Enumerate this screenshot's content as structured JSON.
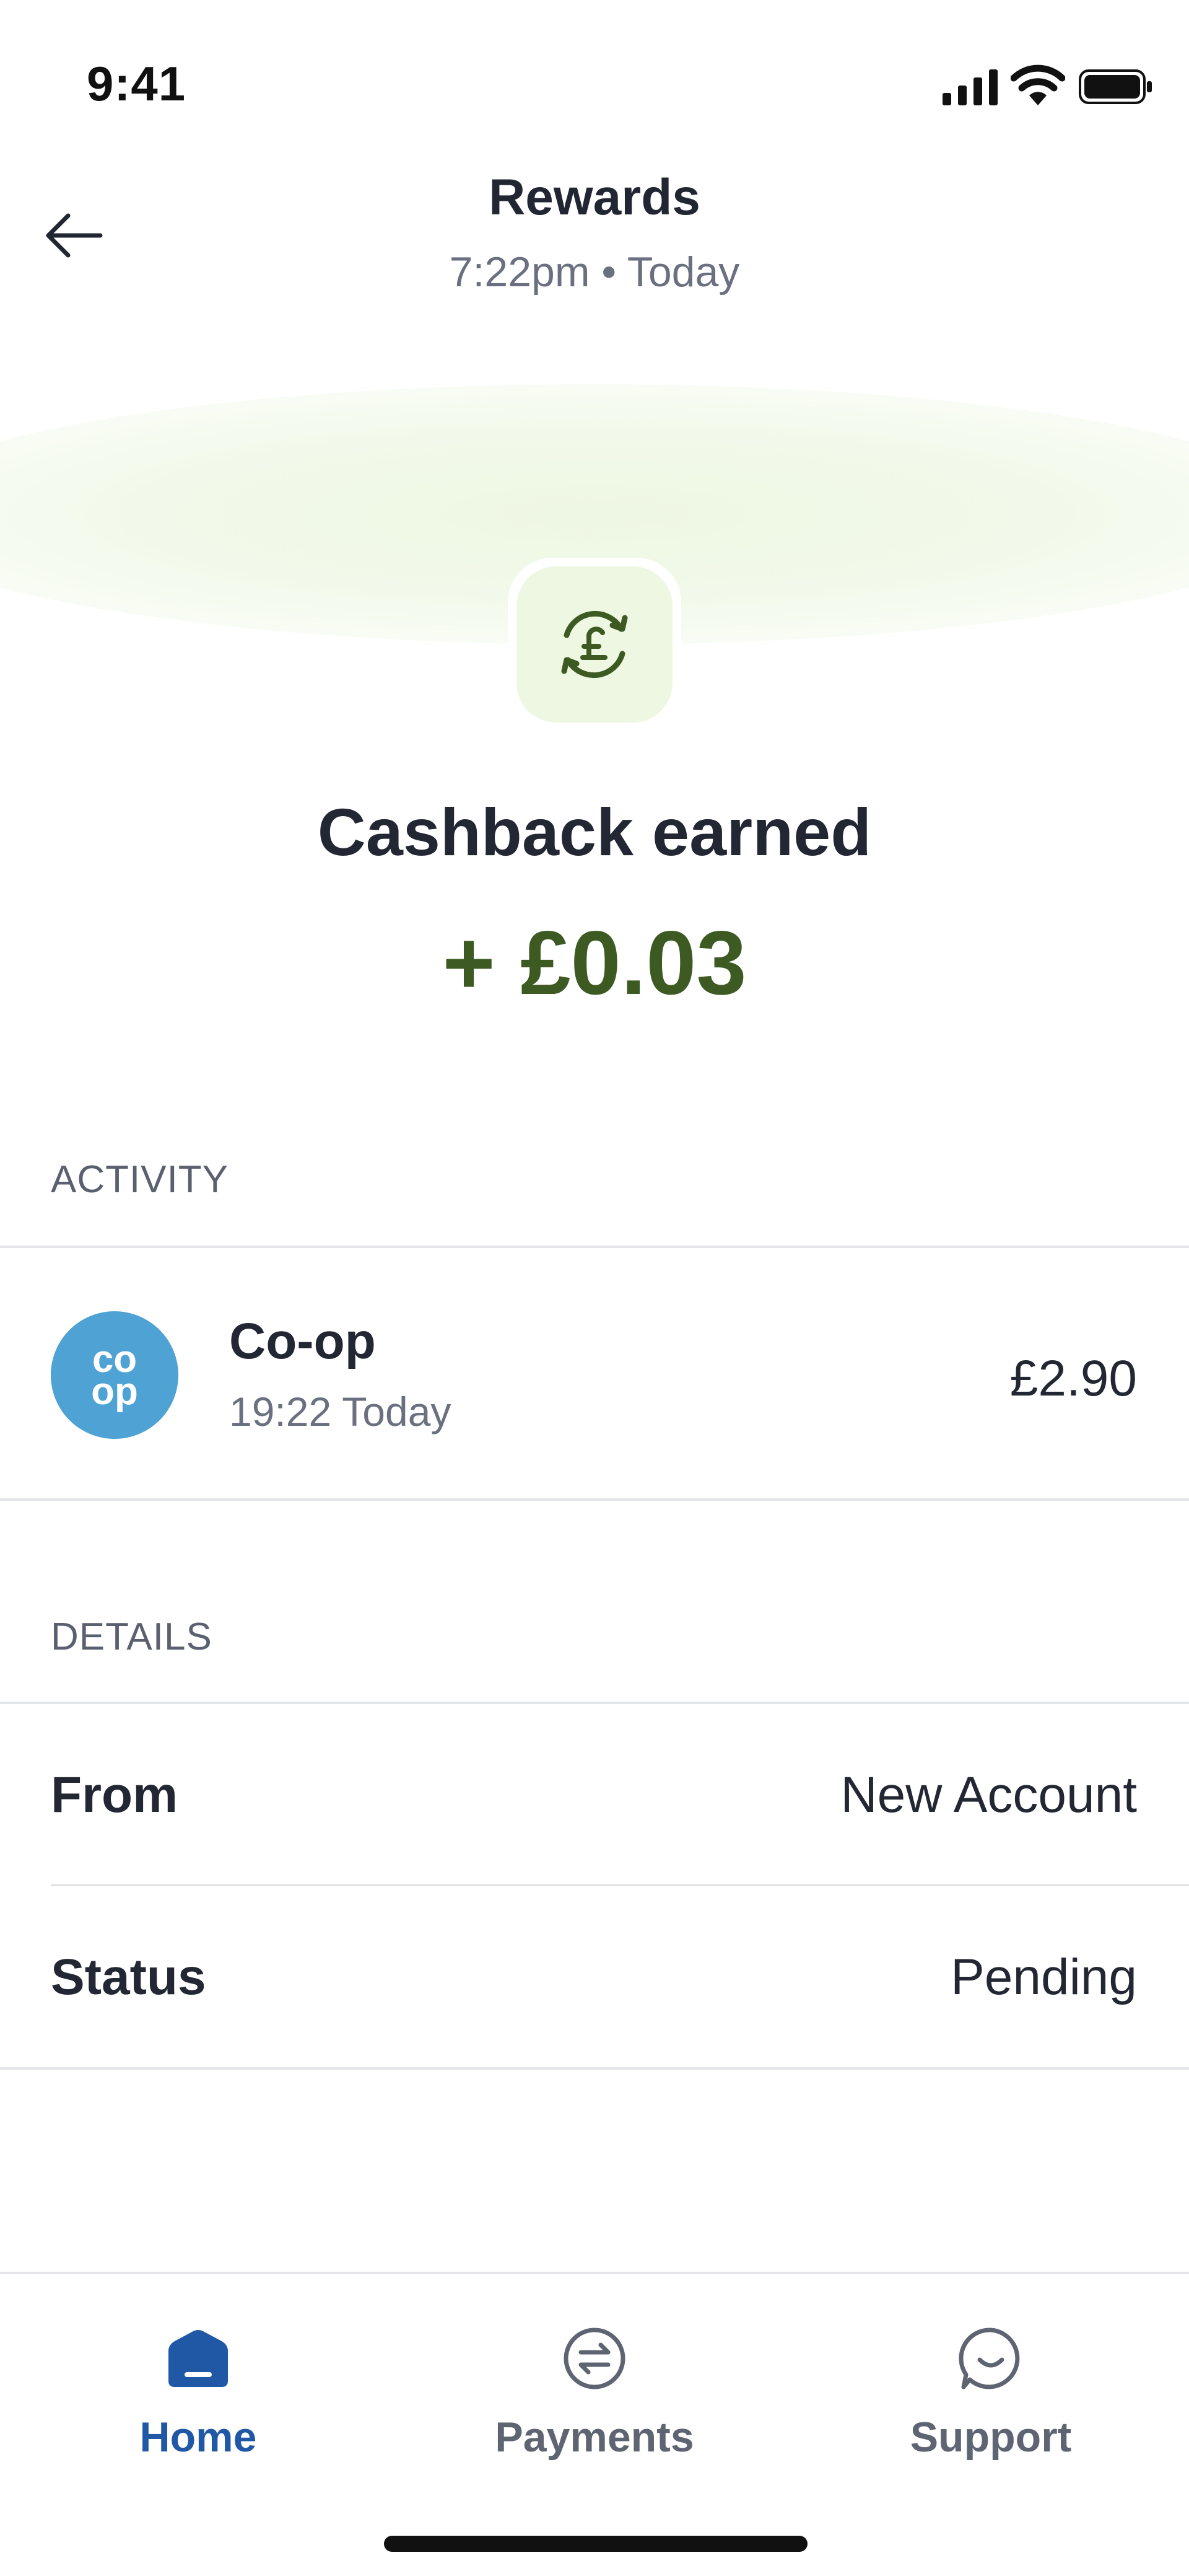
{
  "status_bar": {
    "time": "9:41",
    "icons": [
      "signal-icon",
      "wifi-icon",
      "battery-icon"
    ]
  },
  "header": {
    "title": "Rewards",
    "subtitle": "7:22pm • Today",
    "back_icon": "arrow-left-icon"
  },
  "hero": {
    "icon": "pound-refresh-icon",
    "title": "Cashback earned",
    "amount": "+ £0.03"
  },
  "activity": {
    "label": "ACTIVITY",
    "merchant": {
      "logo_text_top": "co",
      "logo_text_bottom": "op",
      "name": "Co-op",
      "time": "19:22 Today",
      "amount": "£2.90"
    }
  },
  "details": {
    "label": "DETAILS",
    "rows": [
      {
        "label": "From",
        "value": "New Account"
      },
      {
        "label": "Status",
        "value": "Pending"
      }
    ]
  },
  "tab_bar": {
    "active": "Home",
    "tabs": [
      {
        "label": "Home",
        "icon": "home-icon"
      },
      {
        "label": "Payments",
        "icon": "payments-icon"
      },
      {
        "label": "Support",
        "icon": "support-chat-icon"
      }
    ]
  },
  "colors": {
    "accent_green": "#3c5a22",
    "tile_green": "#eef7e1",
    "active_blue": "#2058a6",
    "coop_blue": "#4ea2d4",
    "muted_text": "#6b7080"
  }
}
